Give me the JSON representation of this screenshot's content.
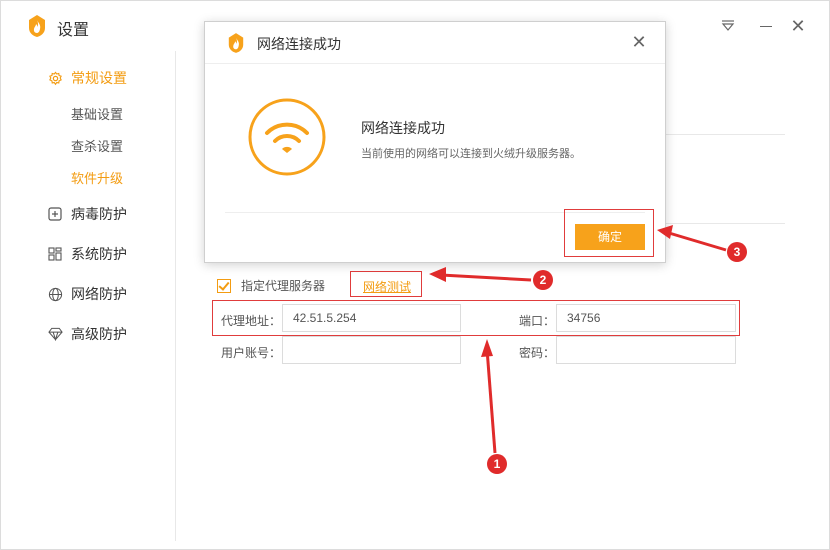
{
  "app": {
    "title": "设置"
  },
  "titlebar": {
    "menu_icon": "triangle-menu-icon",
    "min_icon": "minimize-icon",
    "close_icon": "close-icon"
  },
  "sidebar": {
    "groups": [
      {
        "label": "常规设置",
        "icon": "gear-icon",
        "active": true
      },
      {
        "label": "病毒防护",
        "icon": "plus-square-icon"
      },
      {
        "label": "系统防护",
        "icon": "grid-icon"
      },
      {
        "label": "网络防护",
        "icon": "globe-icon"
      },
      {
        "label": "高级防护",
        "icon": "diamond-icon"
      }
    ],
    "subitems": [
      {
        "label": "基础设置"
      },
      {
        "label": "查杀设置"
      },
      {
        "label": "软件升级",
        "active": true
      }
    ]
  },
  "proxy": {
    "checkbox_label": "指定代理服务器",
    "checked": true,
    "test_link": "网络测试",
    "address_label": "代理地址：",
    "address_value": "42.51.5.254",
    "port_label": "端口：",
    "port_value": "34756",
    "user_label": "用户账号：",
    "user_value": "",
    "password_label": "密码：",
    "password_value": ""
  },
  "dialog": {
    "title": "网络连接成功",
    "message_title": "网络连接成功",
    "message_desc": "当前使用的网络可以连接到火绒升级服务器。",
    "ok_label": "确定",
    "close_icon": "close-icon",
    "icon": "wifi-icon"
  },
  "annotations": {
    "callout_1": "1",
    "callout_2": "2",
    "callout_3": "3"
  },
  "colors": {
    "accent": "#f39c12",
    "button": "#f7a21b",
    "annotation": "#e02b2b"
  }
}
